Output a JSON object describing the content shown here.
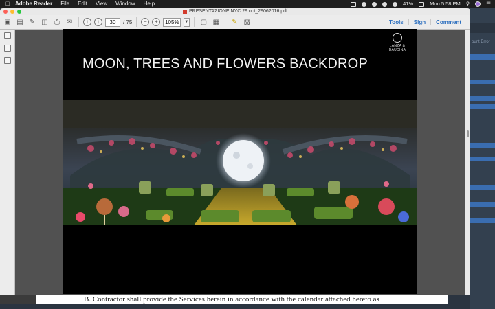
{
  "menubar": {
    "app": "Adobe Reader",
    "items": [
      "File",
      "Edit",
      "View",
      "Window",
      "Help"
    ],
    "battery": "41%",
    "clock": "Mon 5:58 PM"
  },
  "window": {
    "title": "PRESENTAZIONE NYC 29 oct_29062016.pdf"
  },
  "toolbar": {
    "page_current": "30",
    "page_total": "/ 75",
    "zoom": "105%",
    "tools": "Tools",
    "sign": "Sign",
    "comment": "Comment"
  },
  "slide": {
    "title": "MOON, TREES AND FLOWERS BACKDROP",
    "logo_text": "LANZA & BAUCINA"
  },
  "document": {
    "text": "B. Contractor shall provide the Services herein in accordance with the calendar attached hereto as"
  },
  "background_app": {
    "text": "ount Error"
  },
  "colors": {
    "accent": "#2c6fbf",
    "menubar": "#1e1e1e",
    "doc_bg": "#515151"
  }
}
